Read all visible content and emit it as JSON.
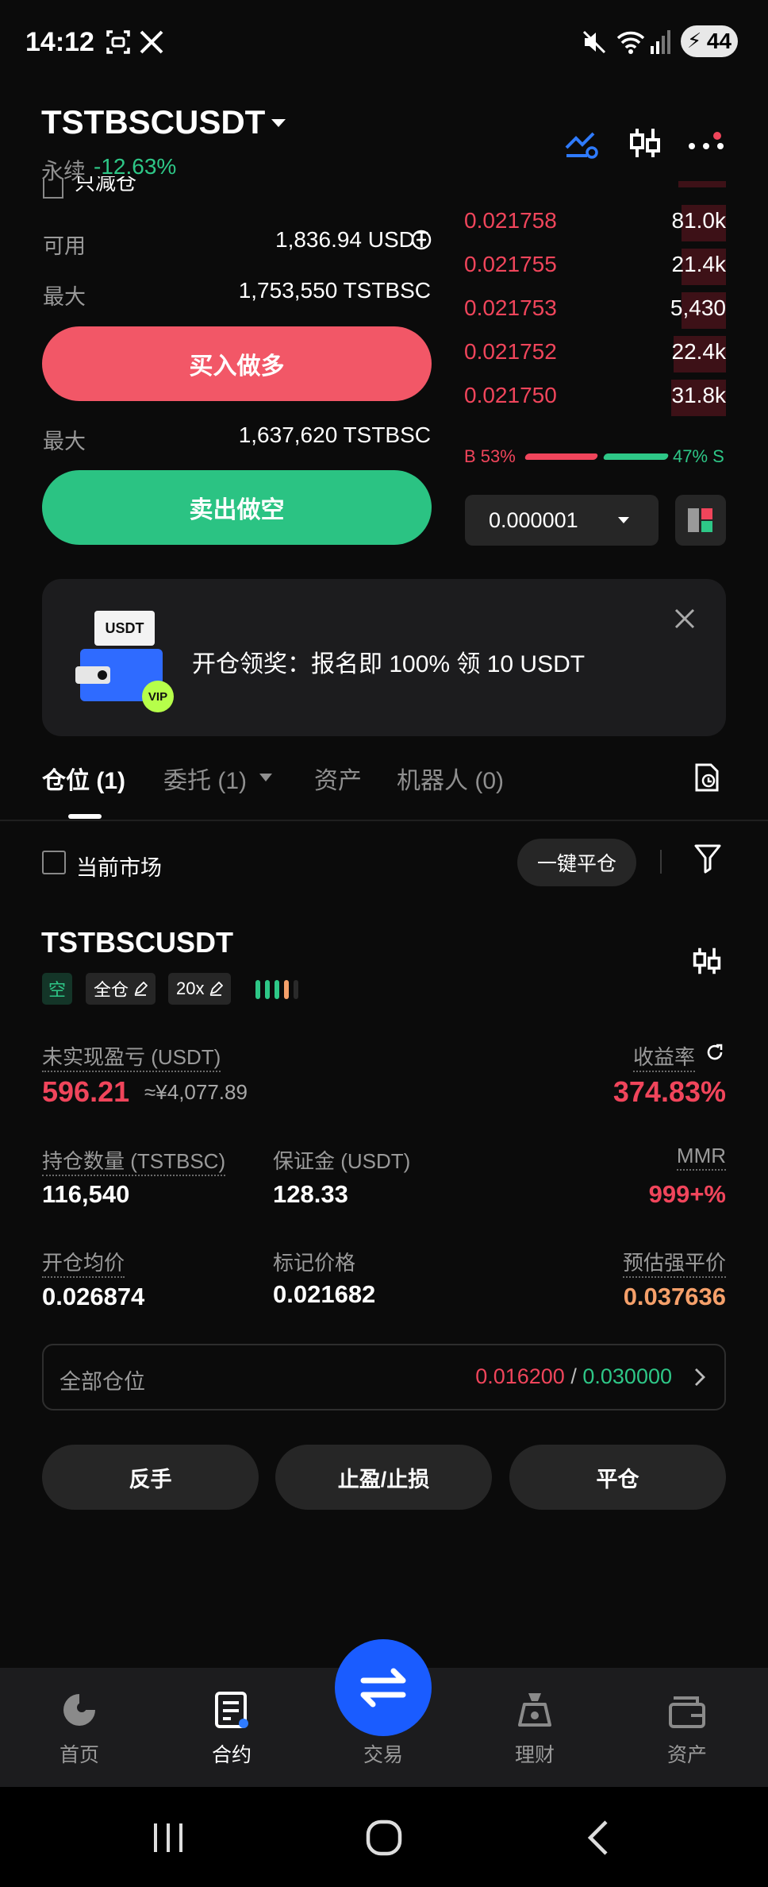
{
  "status_bar": {
    "time": "14:12",
    "battery": "44"
  },
  "header": {
    "symbol": "TSTBSCUSDT",
    "contract_type": "永续",
    "change": "-12.63%",
    "reduce_only": "只减仓"
  },
  "trade": {
    "available_label": "可用",
    "available_value": "1,836.94 USDT",
    "max_label": "最大",
    "max_buy_value": "1,753,550 TSTBSC",
    "buy_button": "买入做多",
    "max_sell_value": "1,637,620 TSTBSC",
    "sell_button": "卖出做空"
  },
  "orderbook": {
    "asks": [
      {
        "price": "0.021758",
        "qty": "81.0k",
        "depth": 0.17
      },
      {
        "price": "0.021755",
        "qty": "21.4k",
        "depth": 0.17
      },
      {
        "price": "0.021753",
        "qty": "5,430",
        "depth": 0.17
      },
      {
        "price": "0.021752",
        "qty": "22.4k",
        "depth": 0.2
      },
      {
        "price": "0.021750",
        "qty": "31.8k",
        "depth": 0.21
      }
    ],
    "buy_ratio": "B 53%",
    "sell_ratio": "47% S",
    "buy_share": 0.53,
    "precision": "0.000001"
  },
  "banner": {
    "badge": "USDT",
    "vip": "VIP",
    "text": "开仓领奖：报名即 100% 领 10 USDT"
  },
  "tabs": {
    "positions": "仓位 (1)",
    "orders": "委托 (1)",
    "assets": "资产",
    "bots": "机器人 (0)"
  },
  "filter": {
    "current_market": "当前市场",
    "close_all": "一键平仓"
  },
  "position": {
    "symbol": "TSTBSCUSDT",
    "side": "空",
    "margin_mode": "全仓",
    "leverage": "20x",
    "pnl_label": "未实现盈亏 (USDT)",
    "pnl_value": "596.21",
    "pnl_cny": "≈¥4,077.89",
    "roe_label": "收益率",
    "roe_value": "374.83%",
    "size_label": "持仓数量 (TSTBSC)",
    "size_value": "116,540",
    "margin_label": "保证金 (USDT)",
    "margin_value": "128.33",
    "mmr_label": "MMR",
    "mmr_value": "999+%",
    "entry_label": "开仓均价",
    "entry_value": "0.026874",
    "mark_label": "标记价格",
    "mark_value": "0.021682",
    "liq_label": "预估强平价",
    "liq_value": "0.037636",
    "all_positions_label": "全部仓位",
    "tp_value": "0.016200",
    "separator": "/",
    "sl_value": "0.030000",
    "reverse_button": "反手",
    "tpsl_button": "止盈/止损",
    "close_button": "平仓"
  },
  "bottom_nav": {
    "home": "首页",
    "contract": "合约",
    "trade": "交易",
    "earn": "理财",
    "assets": "资产"
  },
  "colors": {
    "red": "#f0455b",
    "green": "#2ec787",
    "blue": "#1a5cff",
    "orange": "#f5a06a"
  }
}
